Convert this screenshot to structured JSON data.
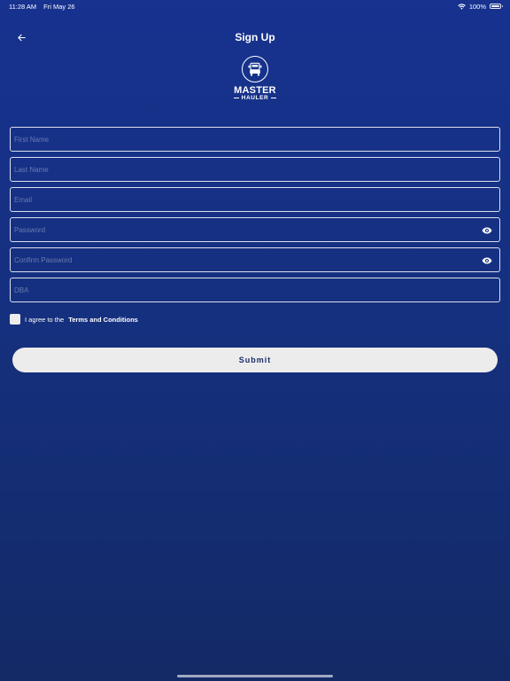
{
  "status_bar": {
    "time": "11:28 AM",
    "date": "Fri May 26",
    "battery": "100%",
    "battery_level": 1.0,
    "icons": [
      "wifi-icon",
      "battery-icon"
    ]
  },
  "header": {
    "title": "Sign Up",
    "back_icon": "back-arrow-icon"
  },
  "logo": {
    "line1": "MASTER",
    "line2": "HAULER",
    "icon": "truck-icon"
  },
  "form": {
    "first_name": {
      "placeholder": "First Name",
      "value": ""
    },
    "last_name": {
      "placeholder": "Last Name",
      "value": ""
    },
    "email": {
      "placeholder": "Email",
      "value": ""
    },
    "password": {
      "placeholder": "Password",
      "value": "",
      "icon": "eye-icon"
    },
    "confirm_password": {
      "placeholder": "Confirm Password",
      "value": "",
      "icon": "eye-icon"
    },
    "dba": {
      "placeholder": "DBA",
      "value": ""
    }
  },
  "terms": {
    "prefix": "I agree to the",
    "link": "Terms and Conditions",
    "checked": false
  },
  "submit": {
    "label": "Submit"
  },
  "colors": {
    "background_top": "#17328f",
    "background_bottom": "#142a66",
    "button_bg": "#ececec",
    "button_text": "#1c2c6a"
  }
}
